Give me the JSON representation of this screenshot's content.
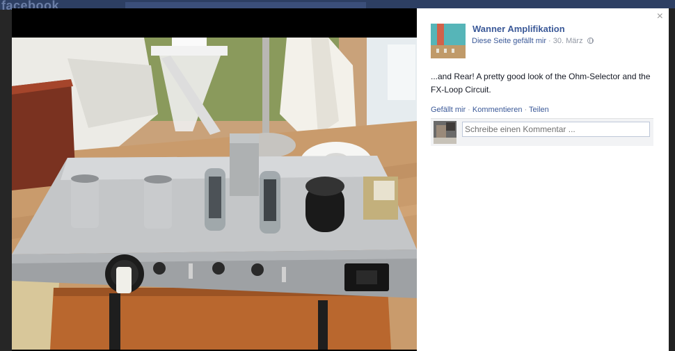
{
  "background": {
    "logo": "facebook"
  },
  "photo": {
    "description_icon": "amplifier-photo"
  },
  "panel": {
    "close_symbol": "×",
    "page_name": "Wanner Amplifikation",
    "like_page": "Diese Seite gefällt mir",
    "dot": " · ",
    "date": "30. März",
    "caption": "...and Rear! A pretty good look of the Ohm-Selector and the FX-Loop Circuit.",
    "actions": {
      "like": "Gefällt mir",
      "comment": "Kommentieren",
      "share": "Teilen",
      "sep": " · "
    },
    "comment_placeholder": "Schreibe einen Kommentar ..."
  },
  "colors": {
    "link": "#3b5998",
    "meta": "#9197a3",
    "text": "#141823"
  }
}
